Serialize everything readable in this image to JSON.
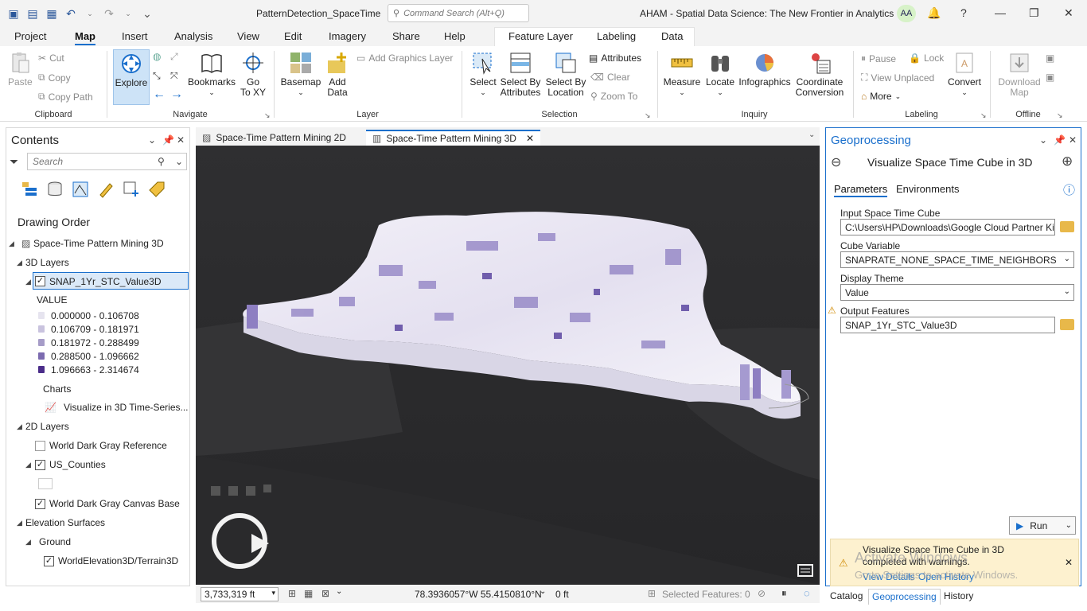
{
  "titlebar": {
    "project_name": "PatternDetection_SpaceTime",
    "command_search_placeholder": "Command Search (Alt+Q)",
    "app_title": "AHAM - Spatial Data Science:  The New Frontier in Analytics",
    "user_initials": "AA",
    "help": "?"
  },
  "menu": {
    "tabs": [
      "Project",
      "Map",
      "Insert",
      "Analysis",
      "View",
      "Edit",
      "Imagery",
      "Share",
      "Help"
    ],
    "active": "Map",
    "contextual_tabs": [
      "Feature Layer",
      "Labeling",
      "Data"
    ]
  },
  "ribbon": {
    "clipboard": {
      "label": "Clipboard",
      "paste": "Paste",
      "cut": "Cut",
      "copy": "Copy",
      "copy_path": "Copy Path"
    },
    "navigate": {
      "label": "Navigate",
      "explore": "Explore",
      "bookmarks": "Bookmarks",
      "goto": "Go\nTo XY"
    },
    "layer": {
      "label": "Layer",
      "basemap": "Basemap",
      "add_data": "Add\nData",
      "add_graphics": "Add Graphics Layer"
    },
    "selection": {
      "label": "Selection",
      "select": "Select",
      "select_by_attributes": "Select By\nAttributes",
      "select_by_location": "Select By\nLocation",
      "attributes": "Attributes",
      "clear": "Clear",
      "zoom_to": "Zoom To"
    },
    "inquiry": {
      "label": "Inquiry",
      "measure": "Measure",
      "locate": "Locate",
      "infographics": "Infographics",
      "coord_conversion": "Coordinate\nConversion"
    },
    "labeling": {
      "label": "Labeling",
      "pause": "Pause",
      "lock": "Lock",
      "view_unplaced": "View Unplaced",
      "more": "More",
      "convert": "Convert"
    },
    "offline": {
      "label": "Offline",
      "download_map": "Download\nMap"
    }
  },
  "contents": {
    "title": "Contents",
    "search_placeholder": "Search",
    "drawing_order": "Drawing Order",
    "map_name": "Space-Time Pattern Mining 3D",
    "layers_3d": "3D Layers",
    "selected_layer": "SNAP_1Yr_STC_Value3D",
    "legend_field": "VALUE",
    "legend": [
      {
        "range": "0.000000 - 0.106708",
        "color": "#e6e4ef"
      },
      {
        "range": "0.106709 - 0.181971",
        "color": "#c9c3de"
      },
      {
        "range": "0.181972 - 0.288499",
        "color": "#a69cc8"
      },
      {
        "range": "0.288500 - 1.096662",
        "color": "#7c6bb0"
      },
      {
        "range": "1.096663 - 2.314674",
        "color": "#4b2d8a"
      }
    ],
    "charts_heading": "Charts",
    "chart_item": "Visualize in 3D Time-Series...",
    "layers_2d": "2D Layers",
    "layer_reference": "World Dark Gray Reference",
    "layer_counties": "US_Counties",
    "layer_canvas": "World Dark Gray Canvas Base",
    "elevation": "Elevation Surfaces",
    "ground": "Ground",
    "terrain": "WorldElevation3D/Terrain3D"
  },
  "mapview": {
    "tabs": [
      "Space-Time Pattern Mining 2D",
      "Space-Time Pattern Mining 3D"
    ],
    "active_tab": "Space-Time Pattern Mining 3D"
  },
  "statusbar": {
    "scale": "3,733,319 ft",
    "coordinates": "78.3936057°W 55.4150810°N",
    "elevation": "0 ft",
    "selected_features": "Selected Features: 0"
  },
  "geoprocessing": {
    "title": "Geoprocessing",
    "tool_name": "Visualize Space Time Cube in 3D",
    "tab_parameters": "Parameters",
    "tab_environments": "Environments",
    "input_label": "Input Space Time Cube",
    "input_value": "C:\\Users\\HP\\Downloads\\Google Cloud Partner Ki",
    "variable_label": "Cube Variable",
    "variable_value": "SNAPRATE_NONE_SPACE_TIME_NEIGHBORS",
    "theme_label": "Display Theme",
    "theme_value": "Value",
    "output_label": "Output Features",
    "output_value": "SNAP_1Yr_STC_Value3D",
    "run": "Run",
    "toast_message": "Visualize Space Time Cube in 3D completed with warnings.",
    "view_details": "View Details",
    "open_history": "Open History",
    "watermark_1": "Activate Windows",
    "watermark_2": "Go to Settings to activate Windows."
  },
  "bottom_tabs": {
    "catalog": "Catalog",
    "geoprocessing": "Geoprocessing",
    "history": "History"
  }
}
